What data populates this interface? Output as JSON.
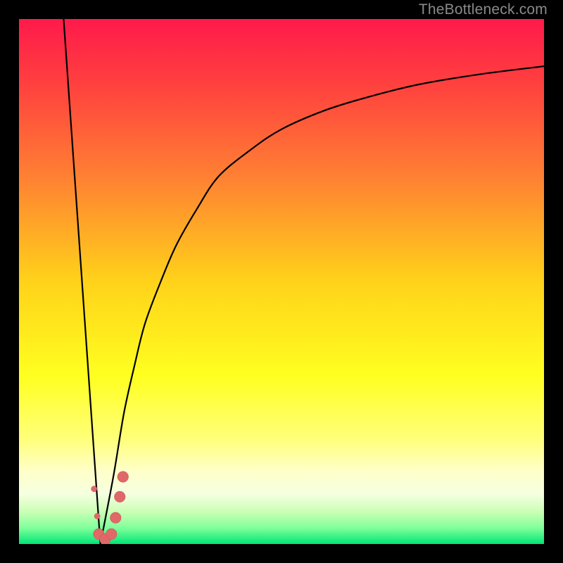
{
  "watermark": {
    "text": "TheBottleneck.com"
  },
  "colors": {
    "black": "#000000",
    "curve": "#000000",
    "marker_fill": "#e06869",
    "marker_stroke": "#c94f50"
  },
  "chart_data": {
    "type": "line",
    "title": "",
    "xlabel": "",
    "ylabel": "",
    "xlim": [
      0,
      100
    ],
    "ylim": [
      0,
      100
    ],
    "grid": false,
    "legend": false,
    "gradient_stops": [
      {
        "pos": 0.0,
        "color": "#ff1a4b"
      },
      {
        "pos": 0.12,
        "color": "#ff3f3f"
      },
      {
        "pos": 0.3,
        "color": "#ff8033"
      },
      {
        "pos": 0.5,
        "color": "#ffd21a"
      },
      {
        "pos": 0.68,
        "color": "#ffff20"
      },
      {
        "pos": 0.8,
        "color": "#ffff7a"
      },
      {
        "pos": 0.86,
        "color": "#ffffc8"
      },
      {
        "pos": 0.905,
        "color": "#f5ffe0"
      },
      {
        "pos": 0.94,
        "color": "#c8ffb4"
      },
      {
        "pos": 0.97,
        "color": "#7dff9a"
      },
      {
        "pos": 1.0,
        "color": "#00e676"
      }
    ],
    "series": [
      {
        "name": "left-descent",
        "x": [
          8.5,
          15.5
        ],
        "y": [
          100,
          0
        ]
      },
      {
        "name": "right-curve",
        "x": [
          15.5,
          18,
          20,
          22,
          24,
          27,
          30,
          34,
          38,
          44,
          50,
          58,
          66,
          76,
          88,
          100
        ],
        "y": [
          0,
          13,
          25,
          34,
          42,
          50,
          57,
          64,
          70,
          75,
          79,
          82.5,
          85,
          87.5,
          89.5,
          91
        ]
      }
    ],
    "markers": [
      {
        "x": 14.3,
        "y": 10.5,
        "r": 0.55
      },
      {
        "x": 14.9,
        "y": 5.3,
        "r": 0.55
      },
      {
        "x": 15.2,
        "y": 1.9,
        "r": 1.05
      },
      {
        "x": 16.4,
        "y": 0.9,
        "r": 1.05
      },
      {
        "x": 17.6,
        "y": 1.9,
        "r": 1.05
      },
      {
        "x": 18.4,
        "y": 5.0,
        "r": 1.05
      },
      {
        "x": 19.2,
        "y": 9.0,
        "r": 1.05
      },
      {
        "x": 19.8,
        "y": 12.8,
        "r": 1.05
      }
    ]
  }
}
